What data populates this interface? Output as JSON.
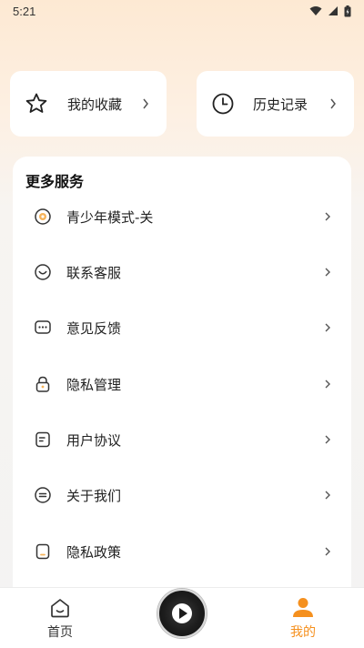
{
  "status_bar": {
    "time": "5:21"
  },
  "top_cards": [
    {
      "label": "我的收藏",
      "icon": "star-icon"
    },
    {
      "label": "历史记录",
      "icon": "clock-icon"
    }
  ],
  "services": {
    "title": "更多服务",
    "items": [
      {
        "label": "青少年模式-关",
        "icon": "youth-mode-icon"
      },
      {
        "label": "联系客服",
        "icon": "smile-icon"
      },
      {
        "label": "意见反馈",
        "icon": "chat-bubble-icon"
      },
      {
        "label": "隐私管理",
        "icon": "lock-icon"
      },
      {
        "label": "用户协议",
        "icon": "document-icon"
      },
      {
        "label": "关于我们",
        "icon": "info-list-icon"
      },
      {
        "label": "隐私政策",
        "icon": "policy-icon"
      }
    ]
  },
  "bottom_nav": {
    "home_label": "首页",
    "mine_label": "我的",
    "active": "mine",
    "accent_color": "#f5901e"
  }
}
